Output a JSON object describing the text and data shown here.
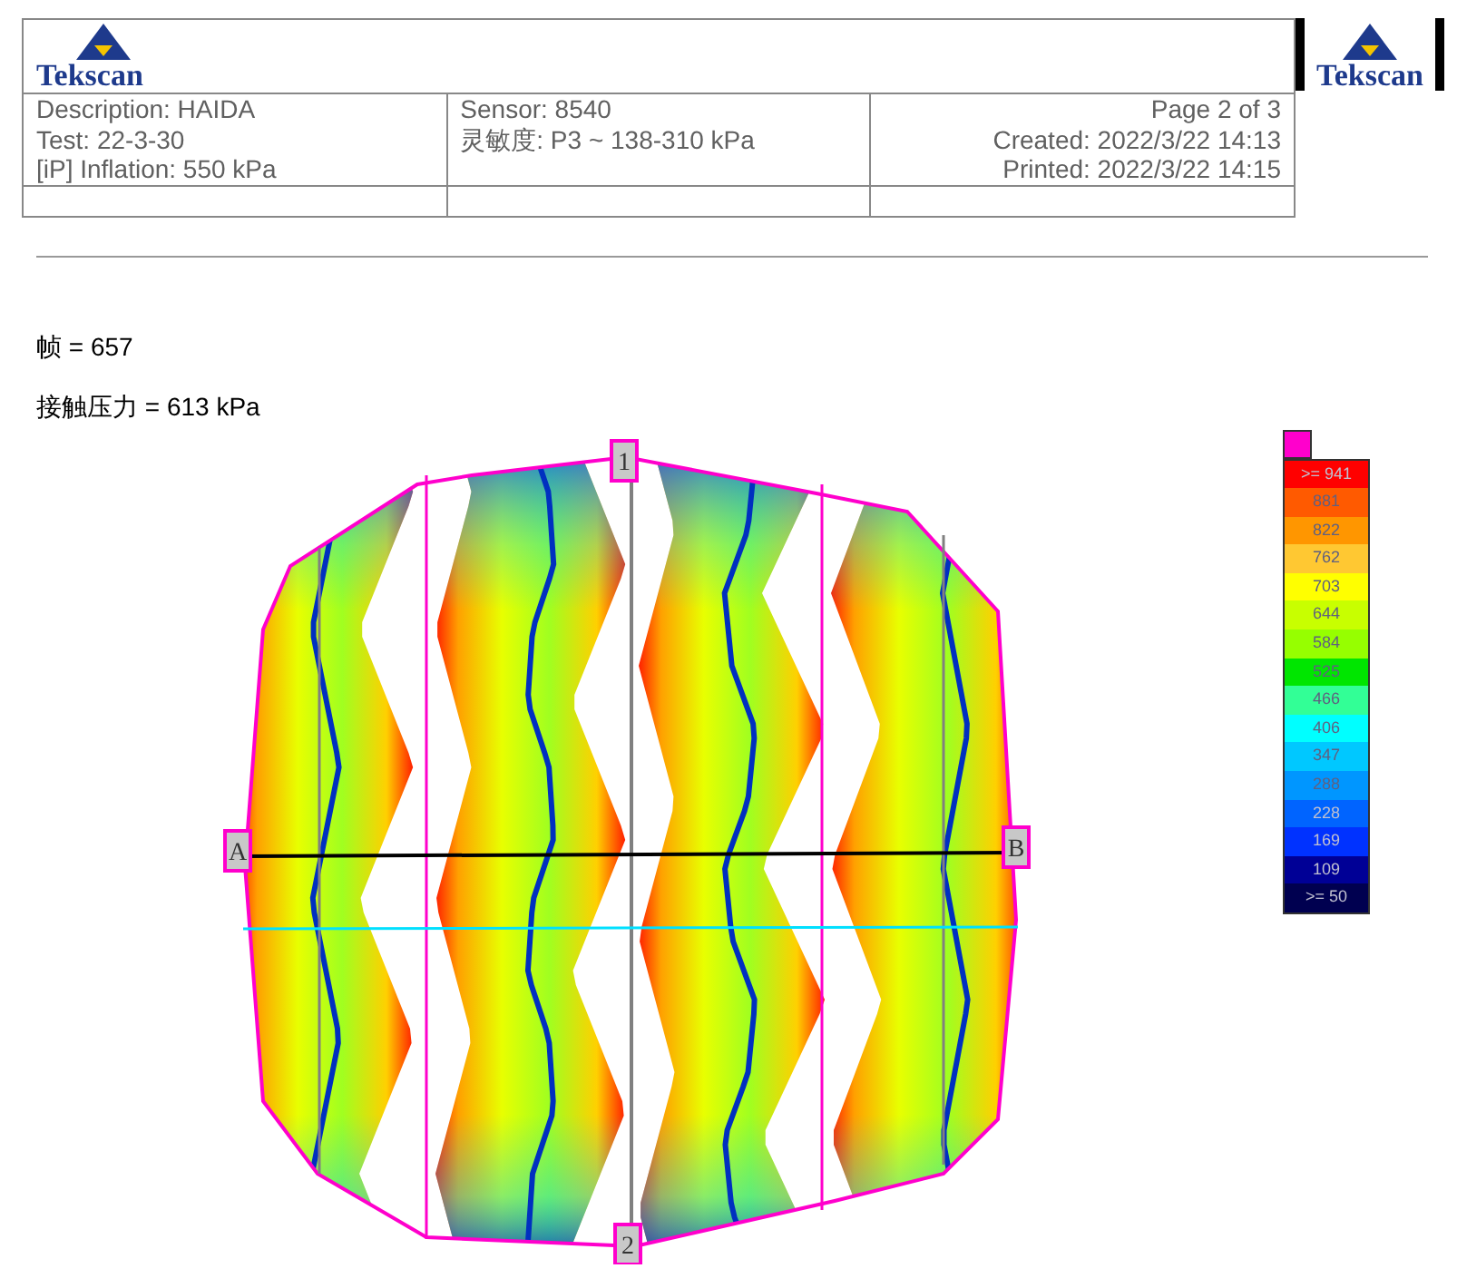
{
  "header": {
    "logo_left": "Tekscan",
    "logo_right": "Tekscan",
    "cells": [
      [
        "Description: HAIDA",
        "Test: 22-3-30",
        "[iP] Inflation: 550 kPa"
      ],
      [
        "Sensor: 8540",
        "灵敏度: P3 ~ 138-310 kPa"
      ],
      [
        "Page 2 of 3",
        "Created: 2022/3/22 14:13",
        "Printed: 2022/3/22 14:15"
      ]
    ]
  },
  "readings": [
    "帧  = 657",
    "接触压力  = 613 kPa"
  ],
  "map": {
    "markers": [
      {
        "kind": "top",
        "label": "1"
      },
      {
        "kind": "bottom",
        "label": "2"
      },
      {
        "kind": "left",
        "label": "A"
      },
      {
        "kind": "right",
        "label": "B"
      }
    ]
  },
  "legend": {
    "items": [
      {
        "label": ">= 941",
        "color": "#ff0000"
      },
      {
        "label": "881",
        "color": "#ff5a00"
      },
      {
        "label": "822",
        "color": "#ff9600"
      },
      {
        "label": "762",
        "color": "#ffc832"
      },
      {
        "label": "703",
        "color": "#ffff00"
      },
      {
        "label": "644",
        "color": "#c8ff00"
      },
      {
        "label": "584",
        "color": "#96ff00"
      },
      {
        "label": "525",
        "color": "#00e600"
      },
      {
        "label": "466",
        "color": "#32ff96"
      },
      {
        "label": "406",
        "color": "#00ffff"
      },
      {
        "label": "347",
        "color": "#00c8ff"
      },
      {
        "label": "288",
        "color": "#0096ff"
      },
      {
        "label": "228",
        "color": "#0064ff"
      },
      {
        "label": "169",
        "color": "#0032ff"
      },
      {
        "label": "109",
        "color": "#000096"
      },
      {
        "label": ">= 50",
        "color": "#000050"
      }
    ]
  }
}
